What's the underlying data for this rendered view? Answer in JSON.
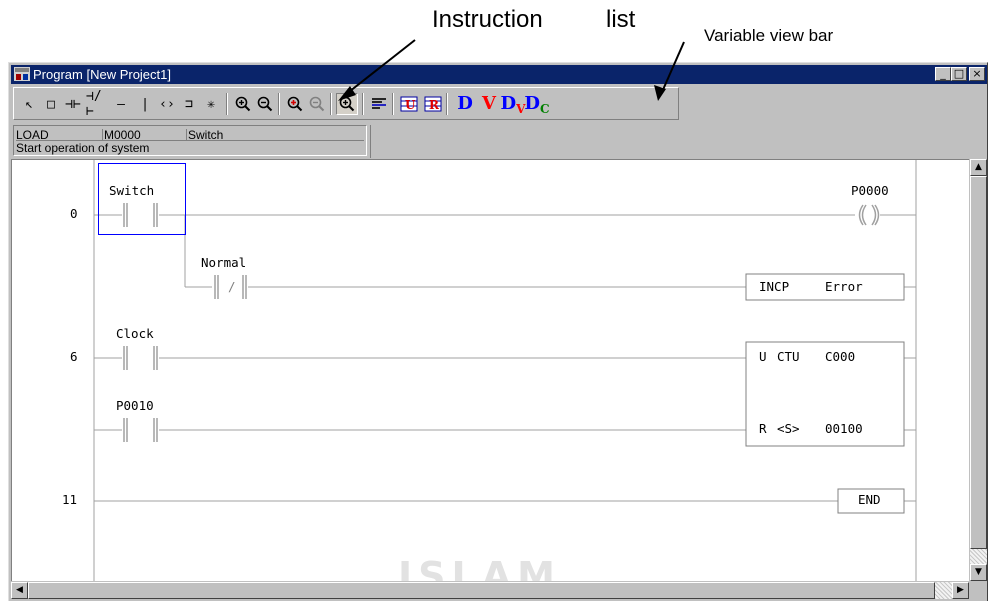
{
  "annotations": {
    "instruction": "Instruction",
    "list": "list",
    "variable_view_bar": "Variable view bar"
  },
  "window": {
    "title": "Program [New Project1]",
    "minimize": "_",
    "restore": "□",
    "close": "×"
  },
  "toolbar": {
    "tools": [
      {
        "glyph": "↖",
        "name": "select-tool"
      },
      {
        "glyph": "□",
        "name": "box-tool"
      },
      {
        "glyph": "⊣⊢",
        "name": "normally-open-contact-tool"
      },
      {
        "glyph": "⊣/⊢",
        "name": "normally-closed-contact-tool"
      },
      {
        "glyph": "—",
        "name": "horizontal-line-tool"
      },
      {
        "glyph": "|",
        "name": "vertical-line-tool"
      },
      {
        "glyph": "‹›",
        "name": "coil-tool"
      },
      {
        "glyph": "⊐",
        "name": "function-tool"
      },
      {
        "glyph": "✳",
        "name": "misc-tool"
      }
    ],
    "letters": {
      "d": "D",
      "v": "V",
      "dv_d": "D",
      "dv_v": "V",
      "dc_d": "D",
      "dc_c": "C"
    },
    "colors": {
      "letter_blue": "#0000ff",
      "letter_red": "#ff0000",
      "letter_green": "#008000"
    }
  },
  "info_panel": {
    "instruction": "LOAD",
    "device": "M0000",
    "variable": "Switch",
    "comment": "Start operation of system"
  },
  "ladder": {
    "step_numbers": [
      "0",
      "6",
      "11"
    ],
    "contacts": {
      "switch": "Switch",
      "normal": "Normal",
      "clock": "Clock",
      "p0010": "P0010"
    },
    "closed_contact_mark": "/",
    "coil": "P0000",
    "incp_instr": "INCP",
    "incp_operand": "Error",
    "ctu_u": "U",
    "ctu_instr": "CTU",
    "ctu_operand": "C000",
    "ctu_r": "R",
    "ctu_s": "<S>",
    "ctu_preset": "00100",
    "end": "END"
  },
  "watermark": "ISLAM",
  "scrollbars": {
    "up": "▲",
    "down": "▼",
    "left": "◀",
    "right": "▶"
  }
}
